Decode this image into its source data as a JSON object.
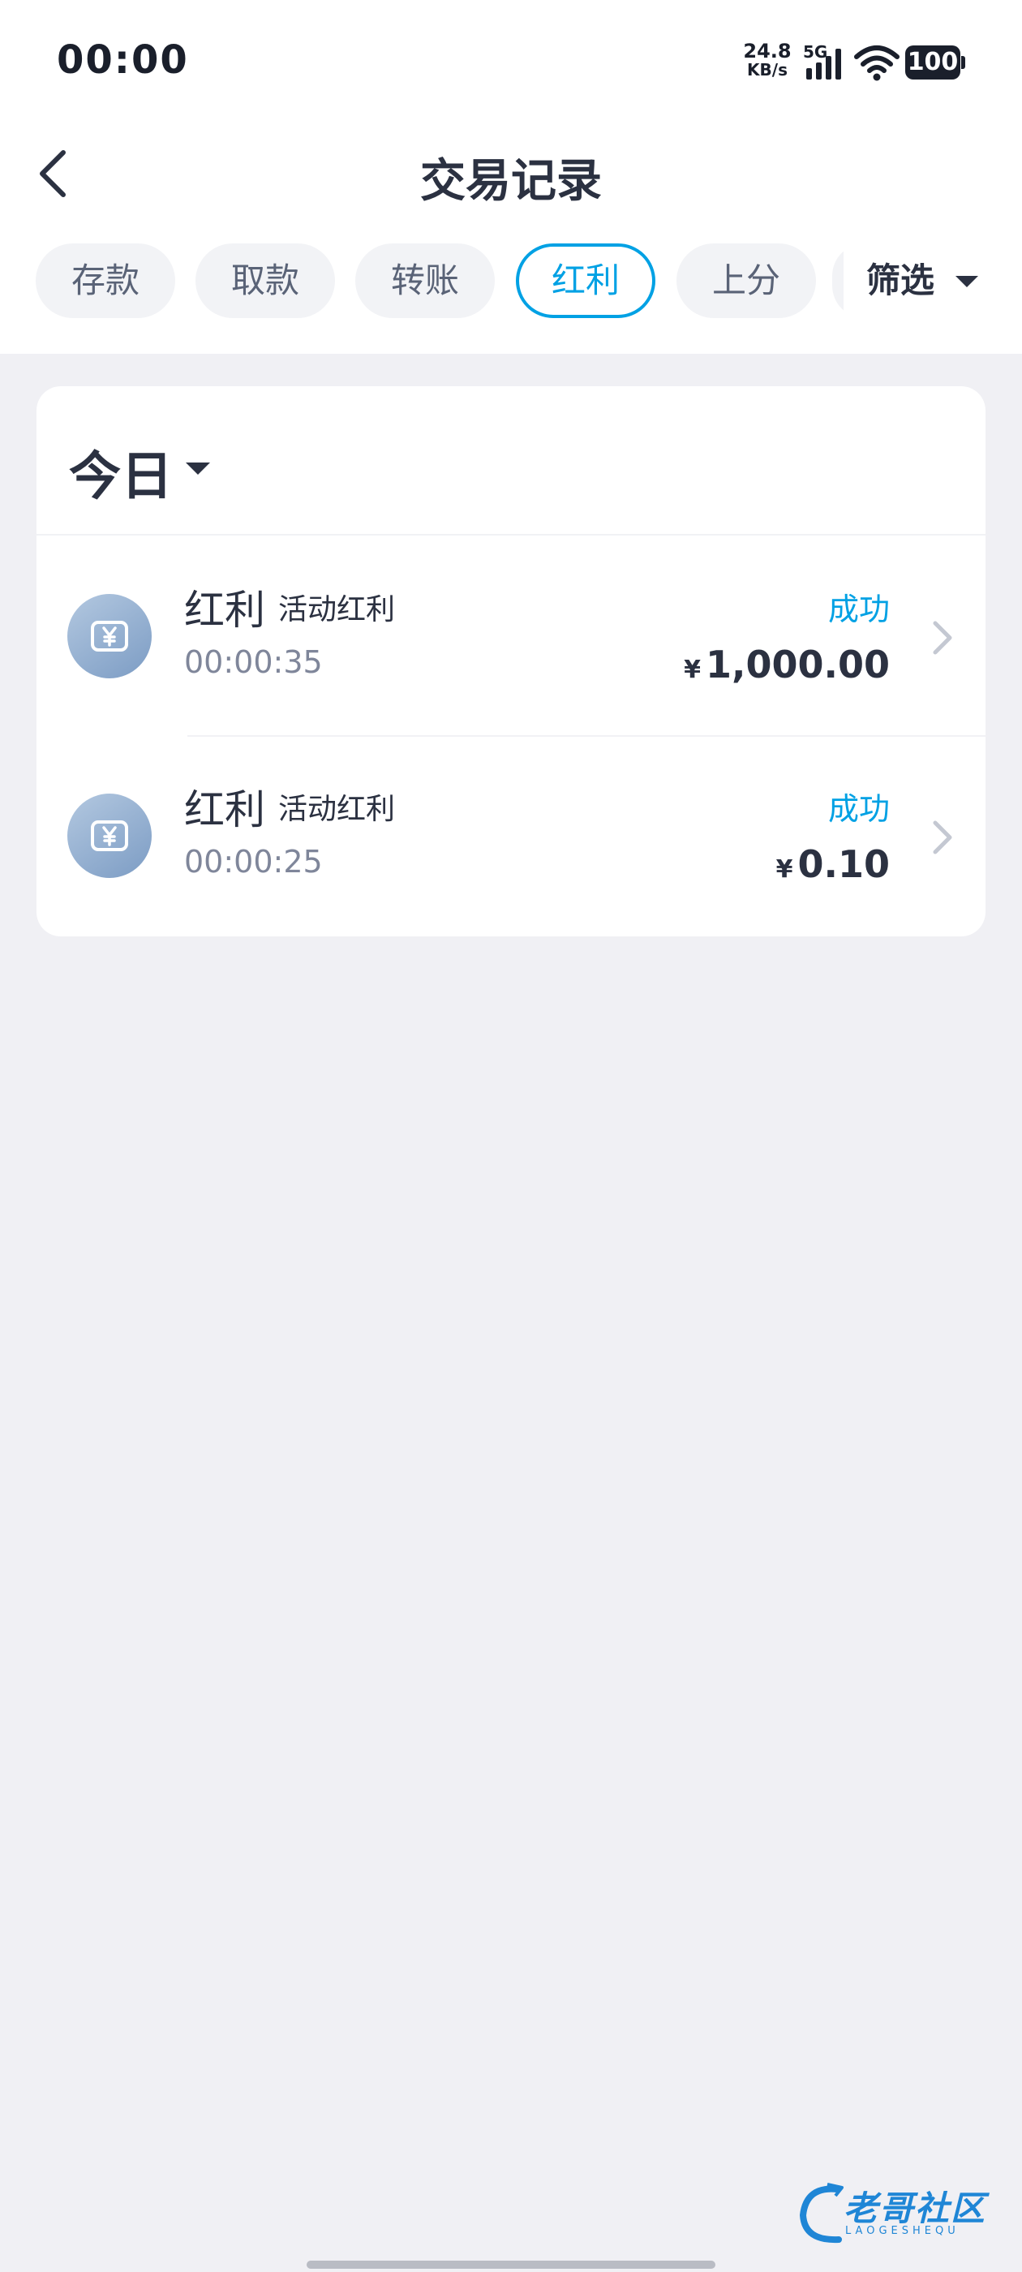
{
  "status_bar": {
    "time": "00:00",
    "net_speed": "24.8",
    "net_unit": "KB/s",
    "network": "5G",
    "battery": "100",
    "icons": [
      "signal-icon",
      "wifi-icon",
      "battery-icon"
    ]
  },
  "nav": {
    "title": "交易记录",
    "back_icon": "back-arrow-icon"
  },
  "tabs": {
    "items": [
      {
        "label": "存款",
        "active": false
      },
      {
        "label": "取款",
        "active": false
      },
      {
        "label": "转账",
        "active": false
      },
      {
        "label": "红利",
        "active": true
      },
      {
        "label": "上分",
        "active": false
      }
    ],
    "filter_label": "筛选",
    "filter_icon": "caret-down-icon"
  },
  "colors": {
    "accent": "#00a1e4",
    "text_primary": "#2b3141",
    "text_secondary": "#7f869a",
    "background": "#f0f0f4"
  },
  "records": {
    "date_label": "今日",
    "date_icon": "caret-down-icon",
    "items": [
      {
        "type": "红利",
        "subtype": "活动红利",
        "time": "00:00:35",
        "status": "成功",
        "currency": "¥",
        "amount": "1,000.00",
        "icon": "yuan-card-icon"
      },
      {
        "type": "红利",
        "subtype": "活动红利",
        "time": "00:00:25",
        "status": "成功",
        "currency": "¥",
        "amount": "0.10",
        "icon": "yuan-card-icon"
      }
    ]
  },
  "watermark": {
    "text": "老哥社区",
    "subtext": "LAOGESHEQU"
  }
}
